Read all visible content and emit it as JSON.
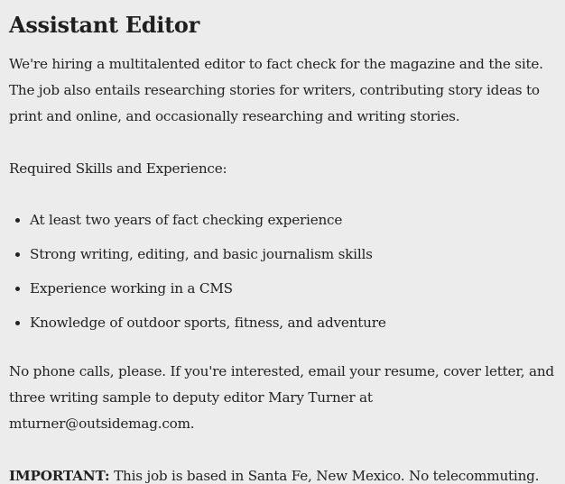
{
  "title": "Assistant Editor",
  "intro": "We're hiring a multitalented editor to fact check for the magazine and the site. The job also entails researching stories for writers, contributing story ideas to print and online, and occasionally researching and writing stories.",
  "skills_heading": "Required Skills and Experience:",
  "skills": [
    "At least two years of fact checking experience",
    "Strong writing, editing, and basic journalism skills",
    "Experience working in a CMS",
    "Knowledge of outdoor sports, fitness, and adventure"
  ],
  "contact": "No phone calls, please. If you're interested, email your resume, cover letter, and three writing sample to deputy editor Mary Turner at mturner@outsidemag.com.",
  "important": {
    "label": "IMPORTANT:",
    "text": " This job is based in Santa Fe, New Mexico. No telecommuting."
  }
}
